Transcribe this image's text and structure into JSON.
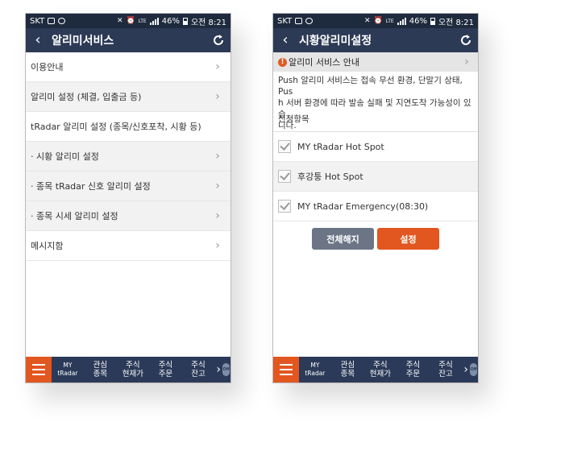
{
  "status_bar": {
    "carrier": "SKT",
    "battery": "46%",
    "time": "오전 8:21",
    "lte": "LTE"
  },
  "left_screen": {
    "title": "알리미서비스",
    "items": [
      {
        "label": "이용안내"
      },
      {
        "label": "알리미 설정 (체결, 입출금 등)"
      },
      {
        "label": "tRadar 알리미 설정 (종목/신호포착, 시황 등)"
      },
      {
        "label": "· 시황 알리미 설정"
      },
      {
        "label": "· 종목 tRadar 신호 알리미 설정"
      },
      {
        "label": "· 종목 시세 알리미 설정"
      },
      {
        "label": "메시지함"
      }
    ]
  },
  "right_screen": {
    "title": "시황알리미설정",
    "section_title": "알리미 서비스 안내",
    "notice_lines": [
      "Push 알리미 서비스는 접속 무선 환경, 단말기 상태, Pus",
      "h 서버 환경에 따라 발송 실패 및 지연도착 가능성이 있습",
      "니다."
    ],
    "apply_header": "신청항목",
    "options": [
      {
        "label": "MY tRadar Hot Spot",
        "checked": true
      },
      {
        "label": "후강퉁 Hot Spot",
        "checked": true
      },
      {
        "label": "MY tRadar Emergency(08:30)",
        "checked": true
      }
    ],
    "buttons": {
      "clear_all": "전체해지",
      "apply": "설정"
    }
  },
  "bottom_nav": {
    "items": [
      {
        "label": "MY\ntRadar"
      },
      {
        "label": "관심\n종목"
      },
      {
        "label": "주식\n현재가"
      },
      {
        "label": "주식\n주문"
      },
      {
        "label": "주식\n잔고"
      }
    ],
    "more": "›",
    "toggle": "Off"
  },
  "colors": {
    "header": "#2d3a56",
    "status": "#1e2a3d",
    "accent": "#e2561f",
    "button_gray": "#6b7586"
  }
}
